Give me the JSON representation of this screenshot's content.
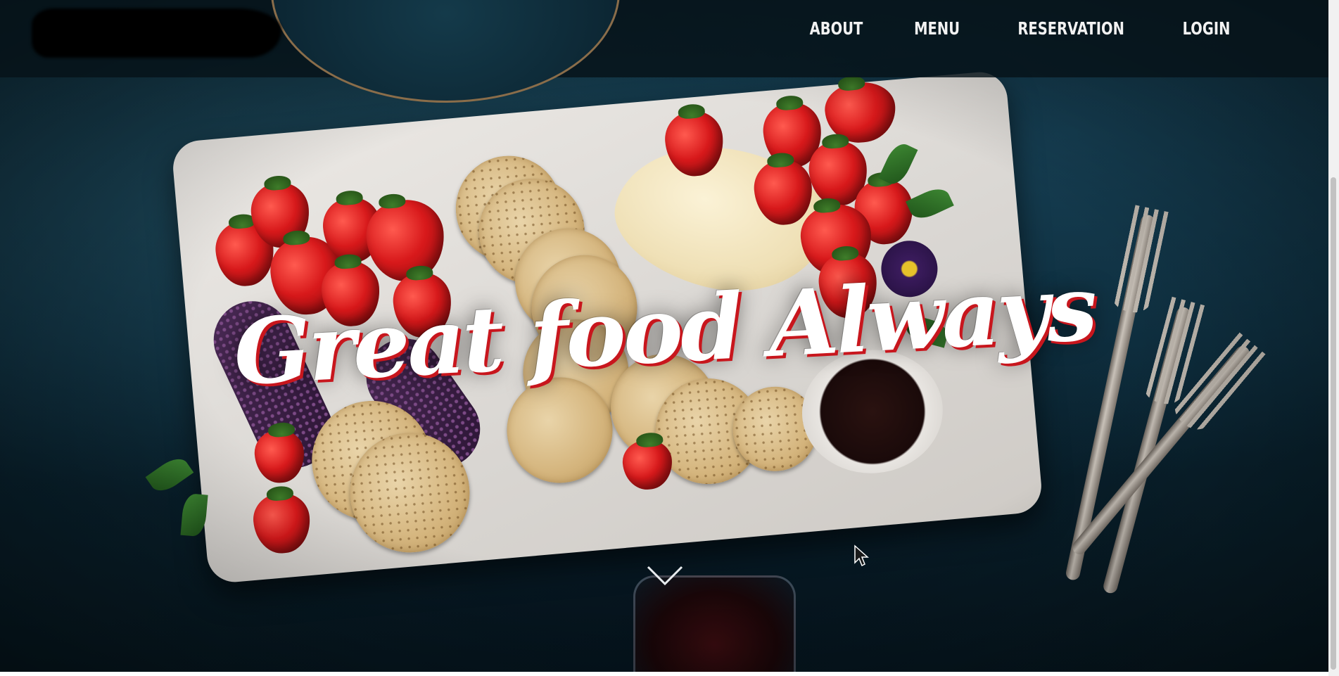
{
  "nav": {
    "items": [
      {
        "label": "ABOUT"
      },
      {
        "label": "MENU"
      },
      {
        "label": "RESERVATION"
      },
      {
        "label": "LOGIN"
      }
    ]
  },
  "hero": {
    "title": "Great food Always",
    "scroll_icon": "chevron-down-icon"
  },
  "colors": {
    "title_fill": "#ffffff",
    "title_shadow": "#c8161d",
    "header_bg": "#06121a",
    "background": "#0c2a38"
  }
}
